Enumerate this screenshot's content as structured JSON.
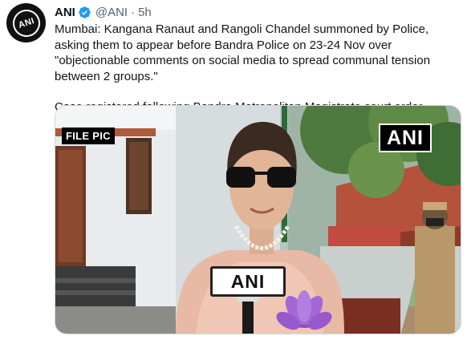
{
  "author": {
    "name": "ANI",
    "handle": "@ANI",
    "separator": "·",
    "time": "5h",
    "avatar_text": "ANI",
    "verified_icon": "verified-badge-icon"
  },
  "tweet": {
    "line1": "Mumbai: Kangana Ranaut and Rangoli Chandel summoned by Police, asking them to appear before Bandra Police on 23-24 Nov over \"objectionable comments on social media to spread communal tension between 2 groups.\"",
    "line2": "Case registered following Bandra Metropolitan Magistrate court order."
  },
  "media": {
    "file_pic_label": "FILE PIC",
    "watermark": "ANI",
    "mic_flag_label": "ANI"
  },
  "colors": {
    "verified": "#1d9bf0",
    "secondary_text": "#536471",
    "primary_text": "#0f1419",
    "border": "#cfd9de"
  }
}
